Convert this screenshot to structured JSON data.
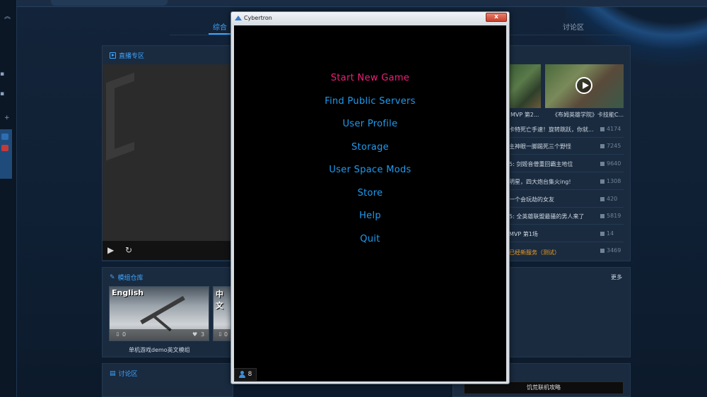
{
  "tabs": {
    "first": "综合",
    "last": "讨论区"
  },
  "live": {
    "title": "直播专区"
  },
  "mods": {
    "title": "模组仓库",
    "more": "更多",
    "cards": [
      {
        "label": "English",
        "downloads": "0",
        "likes": "3",
        "caption": "单机游戏demo英文模组"
      },
      {
        "label": "中文",
        "downloads": "0"
      }
    ]
  },
  "forum": {
    "title": "讨论区"
  },
  "videos": [
    {
      "caption": "MVP 第2..."
    },
    {
      "caption": "《布姆英雄学院》卡技能C..."
    }
  ],
  "list": [
    {
      "title": "卡特死亡手速！旋转跳跃，你就...",
      "count": "4174"
    },
    {
      "title": "主神眼一脚踢死三个野怪",
      "count": "7245"
    },
    {
      "title": "5: 剑姬音僧重回霸主地位",
      "count": "9640"
    },
    {
      "title": "明星，四大炮台集火ing!",
      "count": "1308"
    },
    {
      "title": "一个会玩劫的女友",
      "count": "420"
    },
    {
      "title": "5: 全英雄联盟最骚的男人来了",
      "count": "5819"
    },
    {
      "title": "MVP 第1场",
      "count": "14"
    },
    {
      "title": "",
      "count": "3469"
    }
  ],
  "list_overlay": "已经新服务（测试）",
  "bottom_button": "饥荒联机攻略",
  "dialog": {
    "title": "Cybertron",
    "close": "x",
    "menu": [
      {
        "label": "Start New Game",
        "highlight": true
      },
      {
        "label": "Find Public Servers"
      },
      {
        "label": "User Profile"
      },
      {
        "label": "Storage"
      },
      {
        "label": "User Space Mods"
      },
      {
        "label": "Store"
      },
      {
        "label": "Help"
      },
      {
        "label": "Quit"
      }
    ],
    "users_online": "8"
  },
  "colors": {
    "accent": "#3ea6ff",
    "menu_text": "#1e9cf0",
    "menu_highlight": "#ee1f7a",
    "orange": "#f29d1d"
  }
}
